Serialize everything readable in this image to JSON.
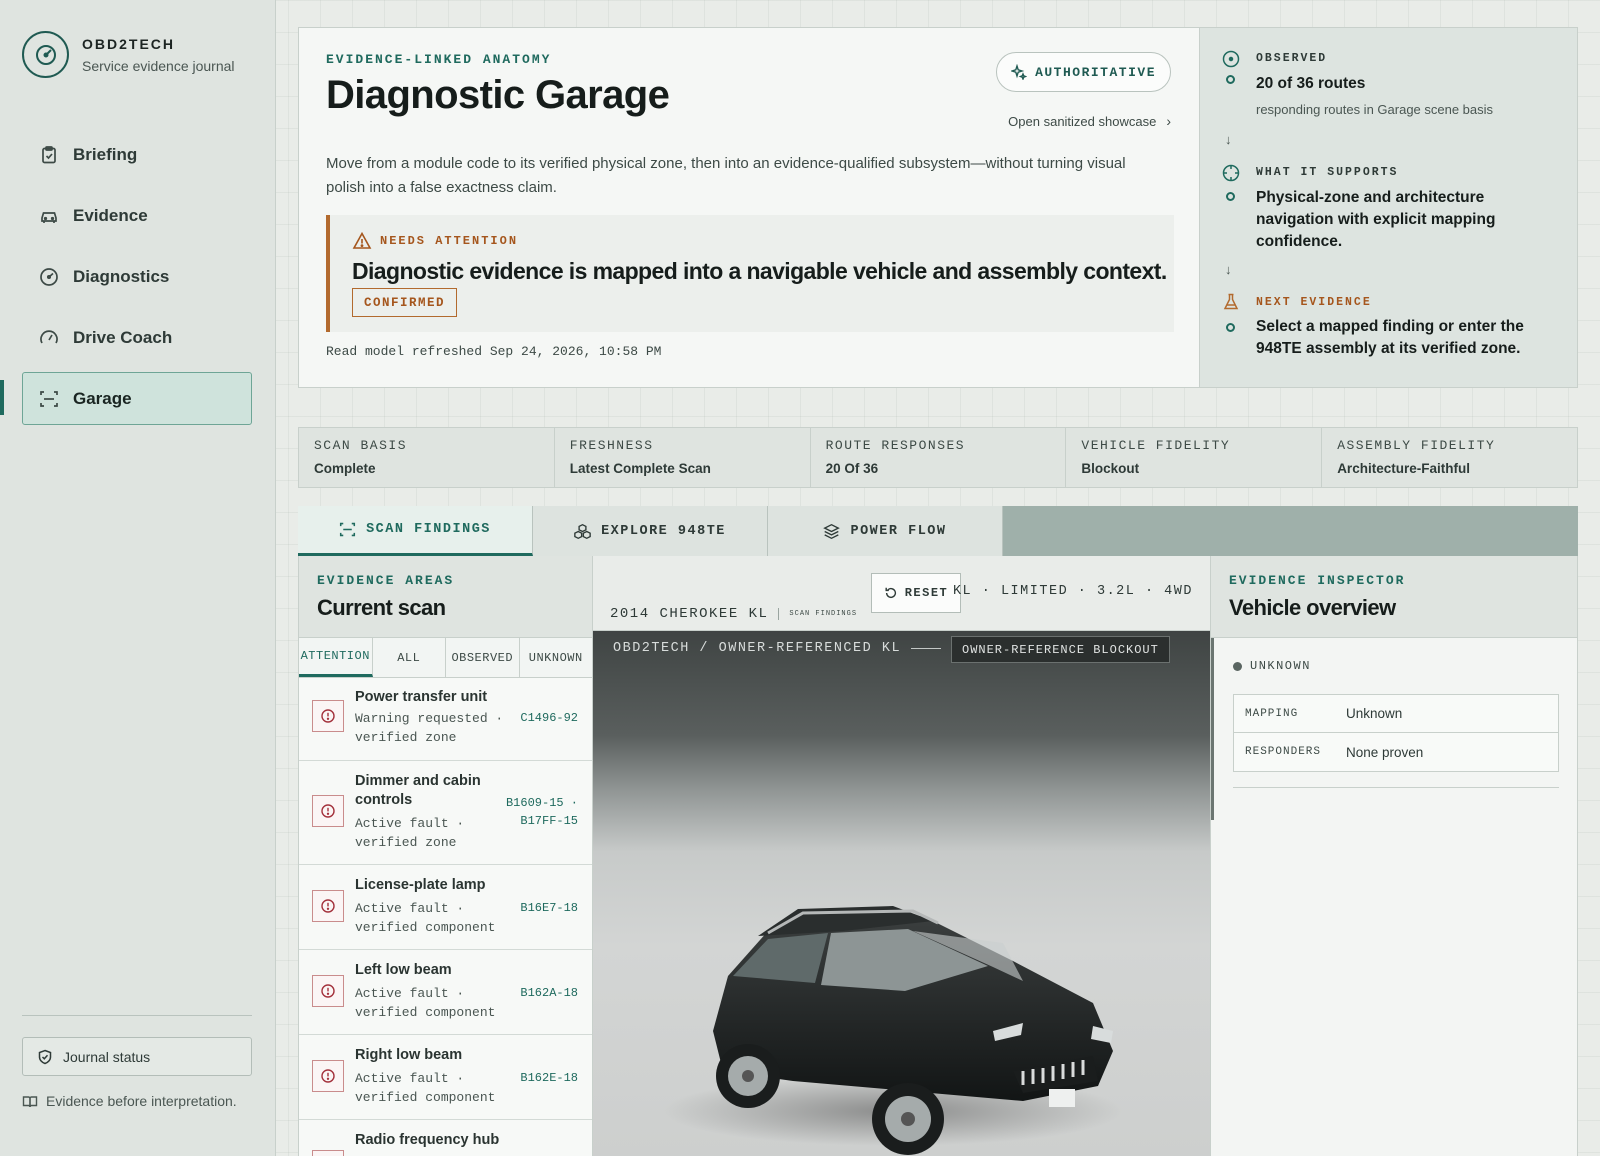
{
  "brand": {
    "name": "OBD2TECH",
    "subtitle": "Service evidence journal"
  },
  "nav": {
    "items": [
      {
        "label": "Briefing",
        "icon": "clipboard-icon"
      },
      {
        "label": "Evidence",
        "icon": "car-icon"
      },
      {
        "label": "Diagnostics",
        "icon": "gauge-icon"
      },
      {
        "label": "Drive Coach",
        "icon": "speedometer-icon"
      },
      {
        "label": "Garage",
        "icon": "scan-icon",
        "active": true
      }
    ]
  },
  "sidebar_footer": {
    "journal_status": "Journal status",
    "note": "Evidence before interpretation."
  },
  "hero": {
    "eyebrow": "EVIDENCE-LINKED ANATOMY",
    "title": "Diagnostic Garage",
    "badge": "AUTHORITATIVE",
    "showcase_link": "Open sanitized showcase",
    "description": "Move from a module code to its verified physical zone, then into an evidence-qualified subsystem—without turning visual polish into a false exactness claim.",
    "attention_label": "NEEDS ATTENTION",
    "attention_title": "Diagnostic evidence is mapped into a navigable vehicle and assembly context.",
    "attention_status": "CONFIRMED",
    "refreshed": "Read model refreshed Sep 24, 2026, 10:58 PM"
  },
  "timeline": {
    "observed_label": "OBSERVED",
    "observed_value": "20 of 36 routes",
    "observed_sub": "responding routes in Garage scene basis",
    "supports_label": "WHAT IT SUPPORTS",
    "supports_value": "Physical-zone and architecture navigation with explicit mapping confidence.",
    "next_label": "NEXT EVIDENCE",
    "next_value": "Select a mapped finding or enter the 948TE assembly at its verified zone."
  },
  "stats": [
    {
      "label": "SCAN BASIS",
      "value": "Complete"
    },
    {
      "label": "FRESHNESS",
      "value": "Latest Complete Scan"
    },
    {
      "label": "ROUTE RESPONSES",
      "value": "20 Of 36"
    },
    {
      "label": "VEHICLE FIDELITY",
      "value": "Blockout"
    },
    {
      "label": "ASSEMBLY FIDELITY",
      "value": "Architecture-Faithful"
    }
  ],
  "tabs": [
    {
      "label": "SCAN FINDINGS",
      "icon": "scan-icon",
      "active": true
    },
    {
      "label": "EXPLORE 948TE",
      "icon": "cubes-icon"
    },
    {
      "label": "POWER FLOW",
      "icon": "layers-icon"
    }
  ],
  "areas": {
    "eyebrow": "EVIDENCE AREAS",
    "title": "Current scan",
    "filters": [
      "ATTENTION",
      "ALL",
      "OBSERVED",
      "UNKNOWN"
    ],
    "findings": [
      {
        "title": "Power transfer unit",
        "desc": "Warning requested · verified zone",
        "code": "C1496-92"
      },
      {
        "title": "Dimmer and cabin controls",
        "desc": "Active fault · verified zone",
        "code": "B1609-15 · B17FF-15"
      },
      {
        "title": "License-plate lamp",
        "desc": "Active fault · verified component",
        "code": "B16E7-18"
      },
      {
        "title": "Left low beam",
        "desc": "Active fault · verified component",
        "code": "B162A-18"
      },
      {
        "title": "Right low beam",
        "desc": "Active fault · verified component",
        "code": "B162E-18"
      },
      {
        "title": "Radio frequency hub",
        "desc": "",
        "code": ""
      }
    ]
  },
  "viewer": {
    "reset": "RESET",
    "spec": "KL · LIMITED · 3.2L · 4WD",
    "model": "2014 CHEROKEE KL",
    "model_tag": "SCAN FINDINGS",
    "scene_label": "OBD2TECH / OWNER-REFERENCED KL",
    "blockout": "OWNER-REFERENCE BLOCKOUT"
  },
  "inspector": {
    "eyebrow": "EVIDENCE INSPECTOR",
    "title": "Vehicle overview",
    "state": "UNKNOWN",
    "rows": [
      {
        "key": "MAPPING",
        "value": "Unknown"
      },
      {
        "key": "RESPONDERS",
        "value": "None proven"
      }
    ]
  }
}
